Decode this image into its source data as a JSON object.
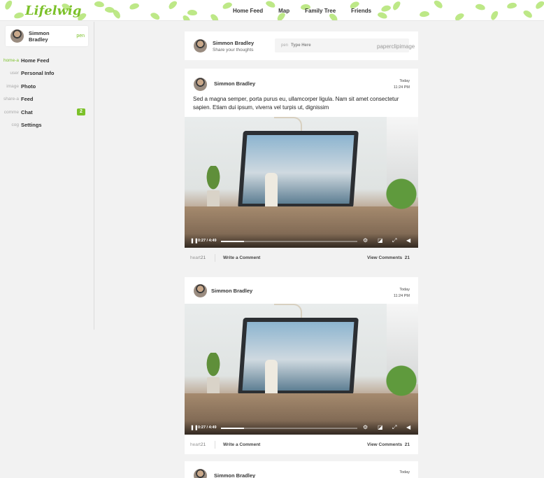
{
  "header": {
    "logo": "Lifelwig",
    "nav": [
      "Home Feed",
      "Map",
      "Family Tree",
      "Friends"
    ]
  },
  "sidebar": {
    "profile": {
      "name": "Simmon Bradley",
      "edit": "pen"
    },
    "items": [
      {
        "icon": "home-a",
        "label": "Home Feed",
        "active": true
      },
      {
        "icon": "user",
        "label": "Personal Info"
      },
      {
        "icon": "image",
        "label": "Photo"
      },
      {
        "icon": "share-a",
        "label": "Feed"
      },
      {
        "icon": "comme",
        "label": "Chat",
        "badge": "2"
      },
      {
        "icon": "cog",
        "label": "Settings"
      }
    ]
  },
  "composer": {
    "name": "Simmon Bradley",
    "subtitle": "Share your thoughts",
    "pen": "pen",
    "placeholder": "Type Here",
    "tools": "paperclipimage"
  },
  "posts": [
    {
      "name": "Simmon Bradley",
      "date_line1": "Today",
      "date_line2": "11:24 PM",
      "text": "Sed a magna semper, porta purus eu, ullamcorper ligula. Nam sit amet consectetur sapien. Etiam dui ipsum, viverra vel turpis ut, dignissim",
      "video": {
        "time": "0:27 / 4:49",
        "progress": 0.17
      },
      "footer": {
        "heart": "heart",
        "likes": "21",
        "write": "Write a Comment",
        "view": "View Comments",
        "comments": "21"
      }
    },
    {
      "name": "Simmon Bradley",
      "date_line1": "Today",
      "date_line2": "11:24 PM",
      "text": "",
      "video": {
        "time": "0:27 / 4:49",
        "progress": 0.17
      },
      "footer": {
        "heart": "heart",
        "likes": "21",
        "write": "Write a Comment",
        "view": "View Comments",
        "comments": "21"
      }
    },
    {
      "name": "Simmon Bradley",
      "date_line1": "Today",
      "date_line2": "",
      "text": ""
    }
  ],
  "colors": {
    "accent": "#7cc12a",
    "leaf": "#b6e67a",
    "background": "#f2f2f2"
  }
}
